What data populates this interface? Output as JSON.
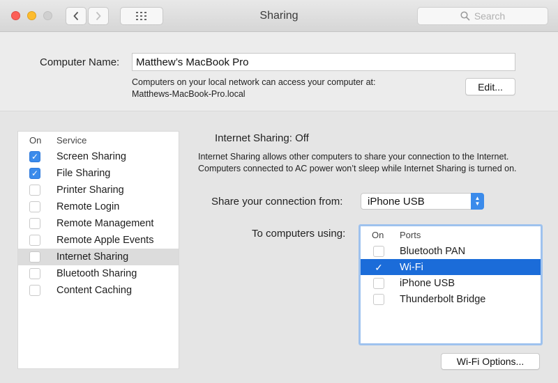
{
  "window": {
    "title": "Sharing",
    "search_placeholder": "Search"
  },
  "computer_name": {
    "label": "Computer Name:",
    "value": "Matthew’s MacBook Pro",
    "description_line1": "Computers on your local network can access your computer at:",
    "description_line2": "Matthews-MacBook-Pro.local",
    "edit_label": "Edit..."
  },
  "services": {
    "header_on": "On",
    "header_service": "Service",
    "items": [
      {
        "label": "Screen Sharing",
        "checked": true
      },
      {
        "label": "File Sharing",
        "checked": true
      },
      {
        "label": "Printer Sharing",
        "checked": false
      },
      {
        "label": "Remote Login",
        "checked": false
      },
      {
        "label": "Remote Management",
        "checked": false
      },
      {
        "label": "Remote Apple Events",
        "checked": false
      },
      {
        "label": "Internet Sharing",
        "checked": false,
        "selected": true
      },
      {
        "label": "Bluetooth Sharing",
        "checked": false
      },
      {
        "label": "Content Caching",
        "checked": false
      }
    ]
  },
  "internet_sharing": {
    "status": "Internet Sharing: Off",
    "description": "Internet Sharing allows other computers to share your connection to the Internet. Computers connected to AC power won’t sleep while Internet Sharing is turned on.",
    "share_from_label": "Share your connection from:",
    "share_from_value": "iPhone USB",
    "to_computers_label": "To computers using:",
    "ports_header_on": "On",
    "ports_header_ports": "Ports",
    "ports": [
      {
        "label": "Bluetooth PAN",
        "checked": false
      },
      {
        "label": "Wi-Fi",
        "checked": true,
        "selected": true
      },
      {
        "label": "iPhone USB",
        "checked": false
      },
      {
        "label": "Thunderbolt Bridge",
        "checked": false
      }
    ],
    "wifi_options_label": "Wi-Fi Options..."
  },
  "colors": {
    "accent": "#3b8beb",
    "selection": "#1b6cd9"
  }
}
